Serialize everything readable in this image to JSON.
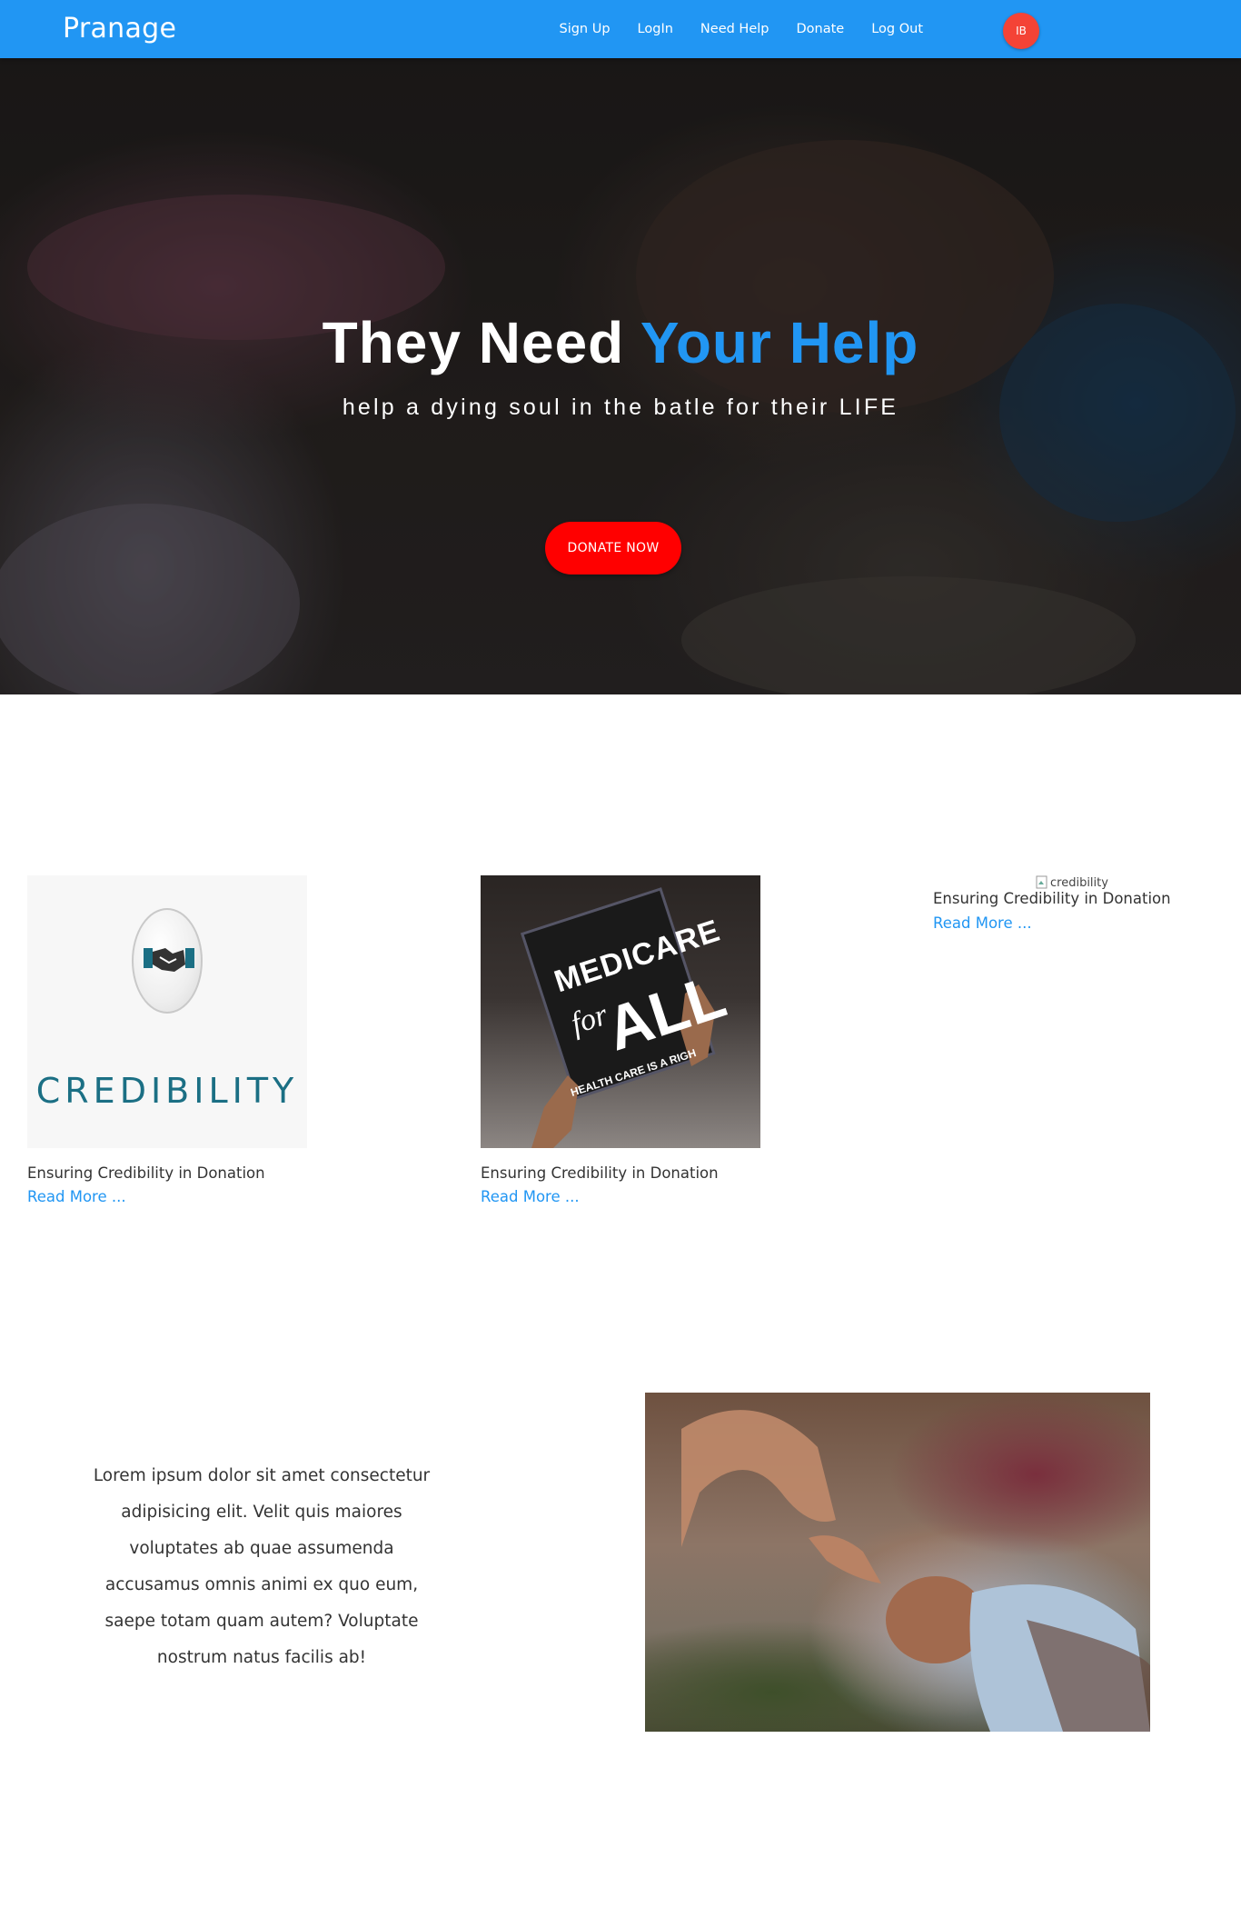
{
  "navbar": {
    "brand": "Pranage",
    "links": [
      "Sign Up",
      "LogIn",
      "Need Help",
      "Donate",
      "Log Out"
    ],
    "avatar_initials": "IB",
    "bg_color": "#2196f3"
  },
  "hero": {
    "title_part1": "They Need",
    "title_part2": "Your Help",
    "subtitle": "help a dying soul in the batle for their LIFE",
    "donate_button": "DONATE NOW",
    "accent_color": "#2196f3",
    "button_color": "#ff0000"
  },
  "cards": [
    {
      "image_text": "CREDIBILITY",
      "title": "Ensuring Credibility in Donation",
      "link": "Read More ..."
    },
    {
      "image_text_1": "MEDICARE",
      "image_text_2": "for",
      "image_text_3": "ALL",
      "image_text_4": "HEALTH CARE IS A RIGH",
      "title": "Ensuring Credibility in Donation",
      "link": "Read More ..."
    },
    {
      "image_alt": "credibility",
      "title": "Ensuring Credibility in Donation",
      "link": "Read More ..."
    }
  ],
  "about": {
    "text": "Lorem ipsum dolor sit amet consectetur adipisicing elit. Velit quis maiores voluptates ab quae assumenda accusamus omnis animi ex quo eum, saepe totam quam autem? Voluptate nostrum natus facilis ab!"
  }
}
